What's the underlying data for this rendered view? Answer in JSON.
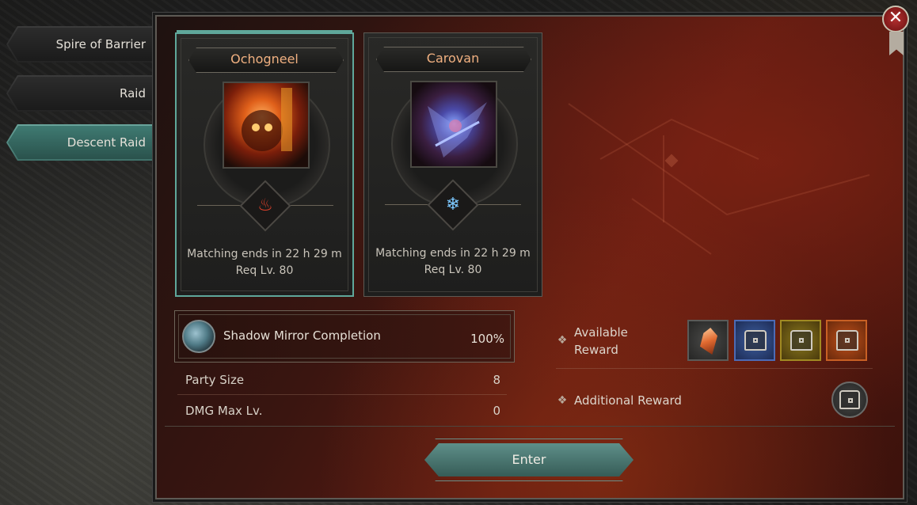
{
  "nav": {
    "tabs": [
      {
        "label": "Spire of Barrier",
        "active": false
      },
      {
        "label": "Raid",
        "active": false
      },
      {
        "label": "Descent Raid",
        "active": true
      }
    ]
  },
  "bosses": [
    {
      "name": "Ochogneel",
      "element": "fire",
      "element_icon": "flame-icon",
      "matching": "Matching ends in 22 h 29 m",
      "req_level": "Req Lv. 80",
      "selected": true
    },
    {
      "name": "Carovan",
      "element": "ice",
      "element_icon": "snowflake-icon",
      "matching": "Matching ends in 22 h 29 m",
      "req_level": "Req Lv. 80",
      "selected": false
    }
  ],
  "completion": {
    "label": "Shadow Mirror Completion",
    "value": "100%"
  },
  "stats": [
    {
      "label": "Party Size",
      "value": "8"
    },
    {
      "label": "DMG Max Lv.",
      "value": "0"
    }
  ],
  "rewards": {
    "available_label_line1": "Available",
    "available_label_line2": "Reward",
    "additional_label": "Additional Reward",
    "items": [
      "fragment-icon",
      "blue-chest-icon",
      "yellow-chest-icon",
      "orange-chest-icon"
    ]
  },
  "actions": {
    "enter_label": "Enter",
    "close_icon": "close-icon"
  },
  "colors": {
    "accent_teal": "#5fa79a",
    "boss_name": "#f0b080",
    "close_red": "#b43030"
  }
}
